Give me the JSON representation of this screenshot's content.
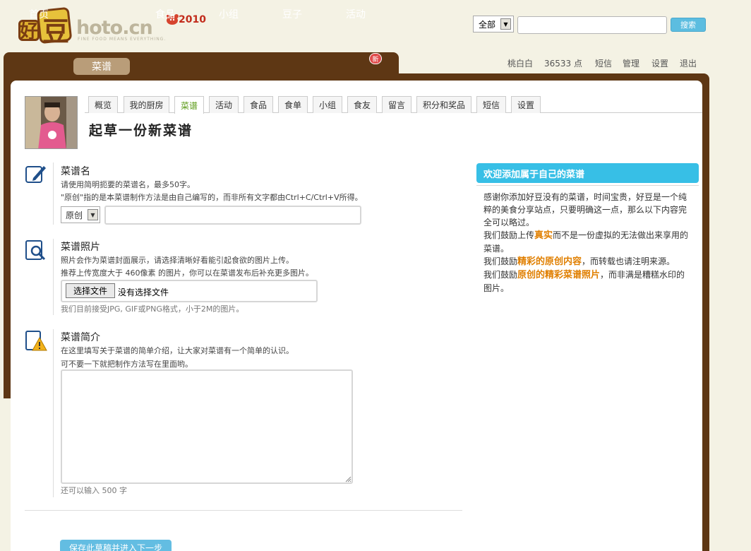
{
  "logo": {
    "text": "hoto.cn",
    "subtitle": "FINE FOOD MEANS EVERYTHING.",
    "year": "2010",
    "char1": "好",
    "char2": "豆"
  },
  "search": {
    "scope": "全部",
    "button": "搜索",
    "query": ""
  },
  "nav": {
    "items": [
      {
        "label": "首页"
      },
      {
        "label": "菜谱"
      },
      {
        "label": "食品"
      },
      {
        "label": "小组"
      },
      {
        "label": "豆子"
      },
      {
        "label": "活动"
      }
    ],
    "badge": "新"
  },
  "user_nav": {
    "username": "桃白白",
    "points": "36533 点",
    "items": [
      "短信",
      "管理",
      "设置",
      "退出"
    ]
  },
  "profile_tabs": [
    "概览",
    "我的厨房",
    "菜谱",
    "活动",
    "食品",
    "食单",
    "小组",
    "食友",
    "留言",
    "积分和奖品",
    "短信",
    "设置"
  ],
  "page_title": "起草一份新菜谱",
  "name_section": {
    "title": "菜谱名",
    "hint1": "请使用简明扼要的菜谱名，最多50字。",
    "hint2": "\"原创\"指的是本菜谱制作方法是由自己编写的，而非所有文字都由Ctrl+C/Ctrl+V所得。",
    "type_value": "原创",
    "name_value": ""
  },
  "photo_section": {
    "title": "菜谱照片",
    "hint1": "照片会作为菜谱封面展示，请选择清晰好看能引起食欲的图片上传。",
    "hint2": "推荐上传宽度大于 460像素 的图片，你可以在菜谱发布后补充更多图片。",
    "file_button": "选择文件",
    "file_status": "没有选择文件",
    "formats": "我们目前接受JPG, GIF或PNG格式，小于2M的图片。"
  },
  "intro_section": {
    "title": "菜谱简介",
    "hint1": "在这里填写关于菜谱的简单介绍，让大家对菜谱有一个简单的认识。",
    "hint2": "可不要一下就把制作方法写在里面哟。",
    "remaining": "还可以输入 500 字"
  },
  "save_button": "保存此草稿并进入下一步",
  "panel": {
    "title": "欢迎添加属于自己的菜谱",
    "p1": "感谢你添加好豆没有的菜谱，时间宝贵，好豆是一个纯粹的美食分享站点，只要明确这一点，那么以下内容完全可以略过。",
    "p2a": "我们鼓励上传",
    "p2b": "真实",
    "p2c": "而不是一份虚拟的无法做出来享用的菜谱。",
    "p3a": "我们鼓励",
    "p3b": "精彩的原创内容",
    "p3c": "，而转载也请注明来源。",
    "p4a": "我们鼓励",
    "p4b": "原创的精彩菜谱照片",
    "p4c": "，而非满是糟糕水印的图片。"
  },
  "colors": {
    "brown": "#5e3714",
    "accent_blue": "#37bfe6",
    "highlight": "#e07f00",
    "active_tab": "#5a9a16"
  }
}
